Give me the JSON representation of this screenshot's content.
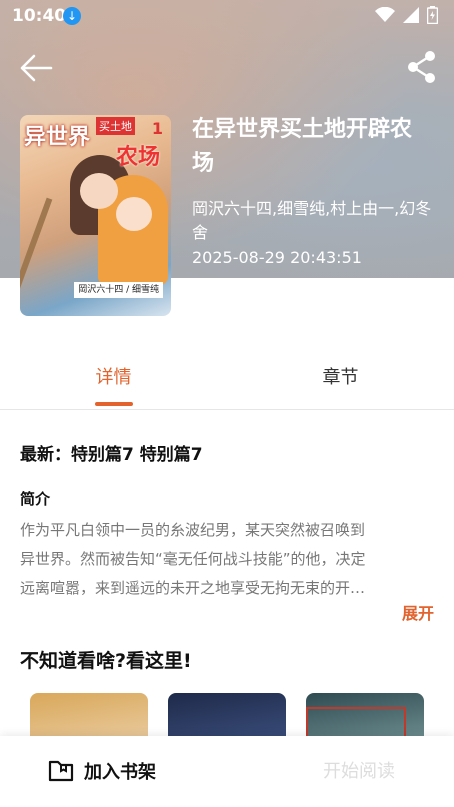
{
  "status_bar": {
    "time": "10:40"
  },
  "book": {
    "title": "在异世界买土地开辟农场",
    "authors": "岡沢六十四,细雪纯,村上由一,幻冬舍",
    "updated": "2025-08-29 20:43:51"
  },
  "cover_art": {
    "title_art": "异世界",
    "subtitle_art": "买土地",
    "farm_art": "农场",
    "volume_art": "1",
    "credit_art": "岡沢六十四 / 细雪纯"
  },
  "tabs": [
    {
      "label": "详情",
      "active": true
    },
    {
      "label": "章节",
      "active": false
    }
  ],
  "detail": {
    "latest": "最新：特别篇7 特别篇7",
    "intro_heading": "简介",
    "intro_lines": [
      "作为平凡白领中一员的糸波纪男，某天突然被召唤到",
      "异世界。然而被告知“毫无任何战斗技能”的他，决定",
      "远离喧嚣，来到遥远的未开之地享受无拘无束的开…"
    ],
    "expand_label": "展开"
  },
  "recommend": {
    "title": "不知道看啥?看这里!"
  },
  "bottom_bar": {
    "add_shelf_label": "加入书架",
    "read_label": "开始阅读"
  },
  "colors": {
    "accent": "#e2632e",
    "text_dark": "#111111",
    "text_muted": "#777777"
  },
  "icons": {
    "back": "arrow-left-icon",
    "share": "share-icon",
    "bookshelf": "bookshelf-icon"
  }
}
